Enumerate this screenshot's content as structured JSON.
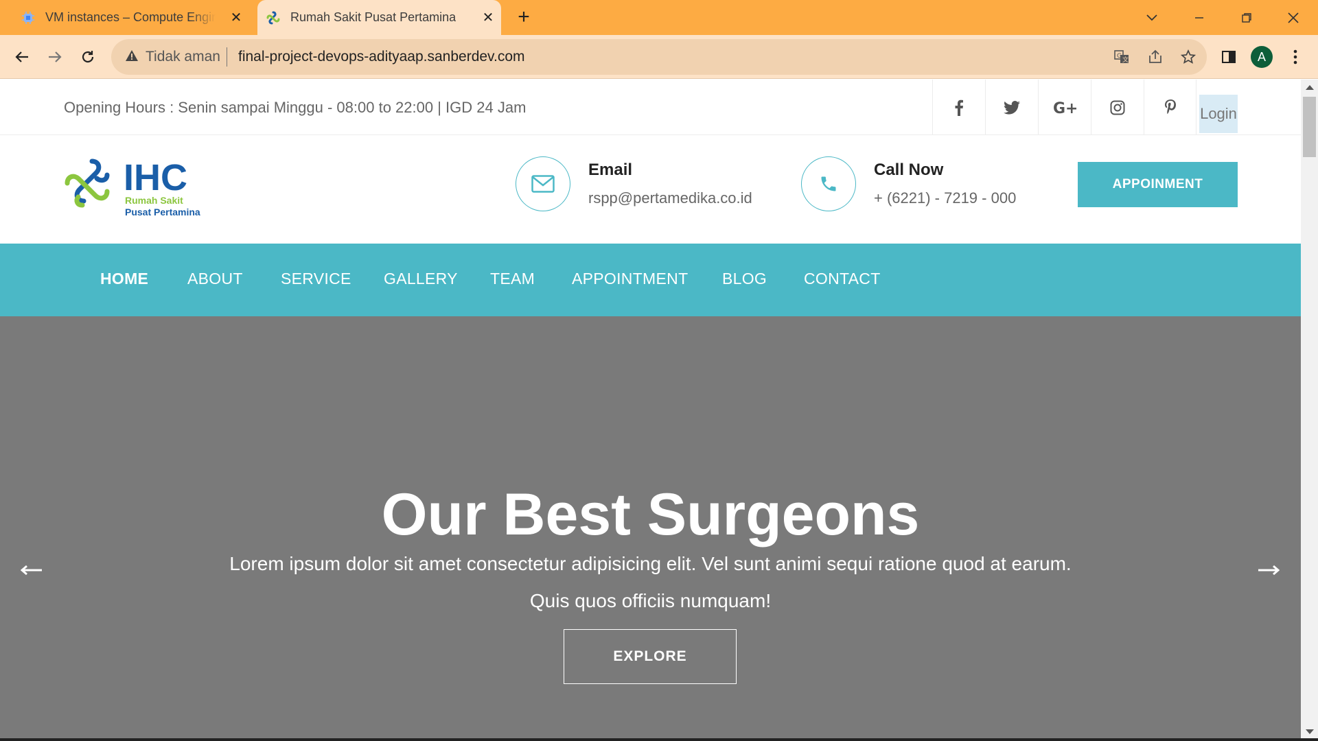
{
  "browser": {
    "tabs": [
      {
        "title": "VM instances – Compute Engine",
        "icon": "compute-engine-icon"
      },
      {
        "title": "Rumah Sakit Pusat Pertamina",
        "icon": "ihc-favicon"
      }
    ],
    "security_label": "Tidak aman",
    "url": "final-project-devops-adityaap.sanberdev.com",
    "profile_initial": "A"
  },
  "topbar": {
    "opening_hours": "Opening Hours : Senin sampai Minggu - 08:00 to 22:00 | IGD 24 Jam",
    "social": [
      "facebook-icon",
      "twitter-icon",
      "google-plus-icon",
      "instagram-icon",
      "pinterest-icon"
    ],
    "login_label": "Login"
  },
  "header": {
    "logo": {
      "brand": "IHC",
      "line1": "Rumah Sakit",
      "line2": "Pusat Pertamina"
    },
    "email": {
      "title": "Email",
      "value": "rspp@pertamedika.co.id"
    },
    "call": {
      "title": "Call Now",
      "value": "+ (6221) - 7219 - 000"
    },
    "appointment_button": "APPOINMENT"
  },
  "nav": {
    "items": [
      "HOME",
      "ABOUT",
      "SERVICE",
      "GALLERY",
      "TEAM",
      "APPOINTMENT",
      "BLOG",
      "CONTACT"
    ],
    "active": "HOME"
  },
  "hero": {
    "title": "Our Best Surgeons",
    "subtitle_line1": "Lorem ipsum dolor sit amet consectetur adipisicing elit. Vel sunt animi sequi ratione quod at earum.",
    "subtitle_line2": "Quis quos officiis numquam!",
    "button": "EXPLORE"
  },
  "colors": {
    "tabbar": "#fdab43",
    "toolbar": "#fde2c6",
    "accent": "#4bb8c6",
    "hero_bg": "#7a7a7a",
    "logo_blue": "#1a5ea8",
    "logo_green": "#8cc63f"
  }
}
